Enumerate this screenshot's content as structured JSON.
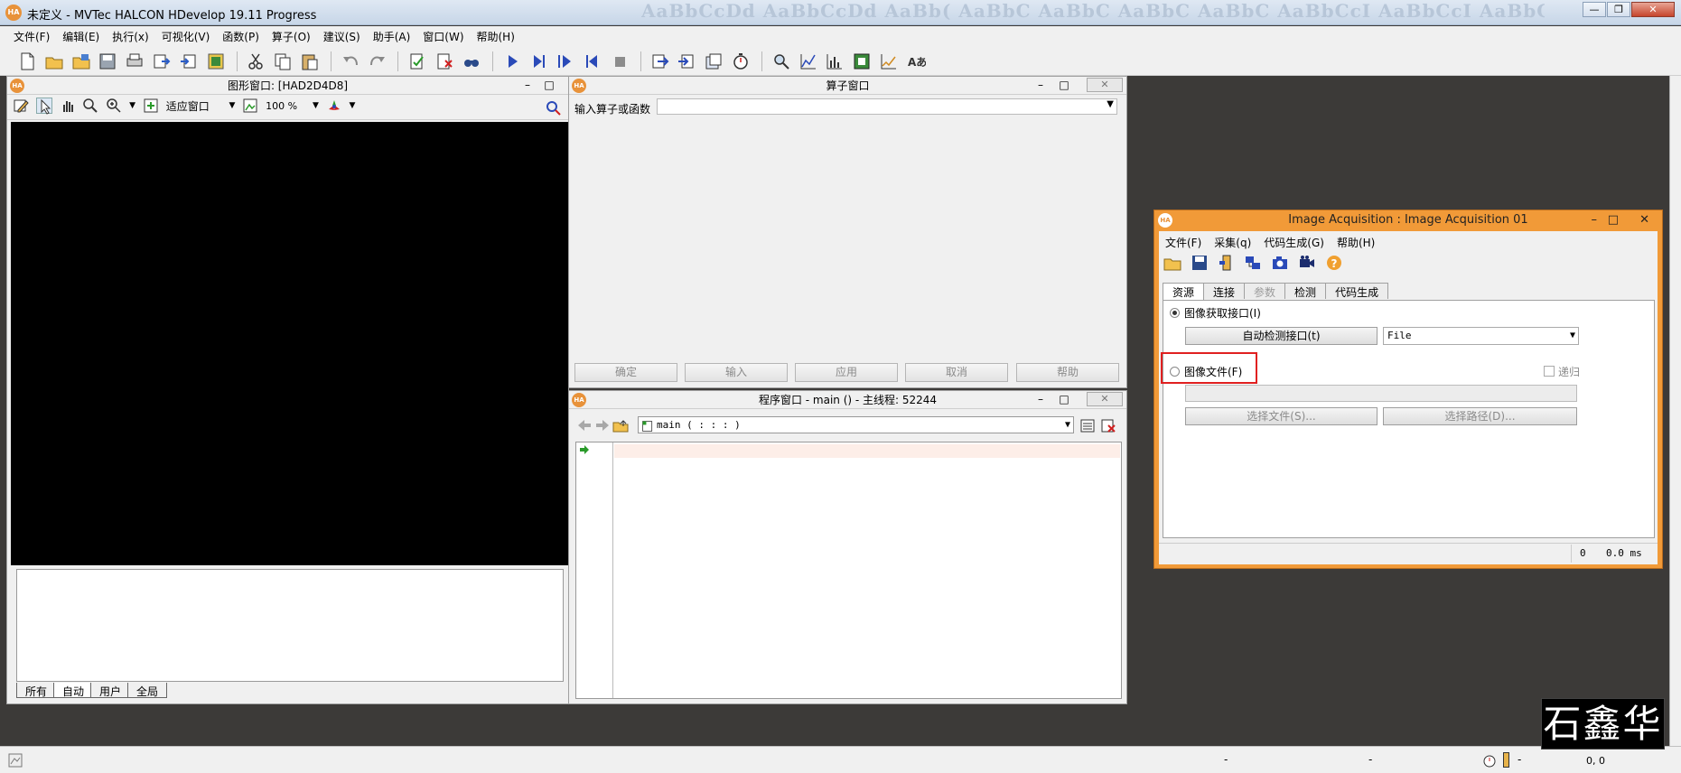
{
  "window": {
    "title": "未定义 - MVTec HALCON HDevelop 19.11 Progress",
    "ribbon_ghost": "AaBbCcDd  AaBbCcDd  AaBb(  AaBbC  AaBbC  AaBbC  AaBbC  AaBbCcI  AaBbCcI  AaBbC  AaBbC  AaBbCcD  AaBbCcD",
    "logo": "HA"
  },
  "menu": [
    "文件(F)",
    "编辑(E)",
    "执行(x)",
    "可视化(V)",
    "函数(P)",
    "算子(O)",
    "建议(S)",
    "助手(A)",
    "窗口(W)",
    "帮助(H)"
  ],
  "graphics_window": {
    "title": "图形窗口: [HAD2D4D8]",
    "fit_label": "适应窗口",
    "zoom_label": "100 %",
    "tabs": [
      "所有",
      "自动",
      "用户",
      "全局"
    ]
  },
  "operator_window": {
    "title": "算子窗口",
    "input_label": "输入算子或函数",
    "buttons": [
      "确定",
      "输入",
      "应用",
      "取消",
      "帮助"
    ]
  },
  "program_window": {
    "title": "程序窗口 - main () - 主线程: 52244",
    "procedure": "main ( : : : )"
  },
  "image_acquisition": {
    "title": "Image Acquisition : Image Acquisition 01",
    "menu": [
      "文件(F)",
      "采集(q)",
      "代码生成(G)",
      "帮助(H)"
    ],
    "tabs": [
      "资源",
      "连接",
      "参数",
      "检测",
      "代码生成"
    ],
    "interface_radio": "图像获取接口(I)",
    "autodetect_button": "自动检测接口(t)",
    "interface_value": "File",
    "file_radio": "图像文件(F)",
    "recursive_label": "递归",
    "select_file_button": "选择文件(S)...",
    "select_dir_button": "选择路径(D)...",
    "status_count": "0",
    "status_time": "0.0 ms"
  },
  "statusbar": {
    "left": "-",
    "mid": "-",
    "coords": "0, 0",
    "coords_dash": "-"
  },
  "watermark": "石鑫华",
  "colors": {
    "orange_frame": "#f19a38",
    "highlight": "#e02020",
    "workspace": "#3c3a38"
  }
}
